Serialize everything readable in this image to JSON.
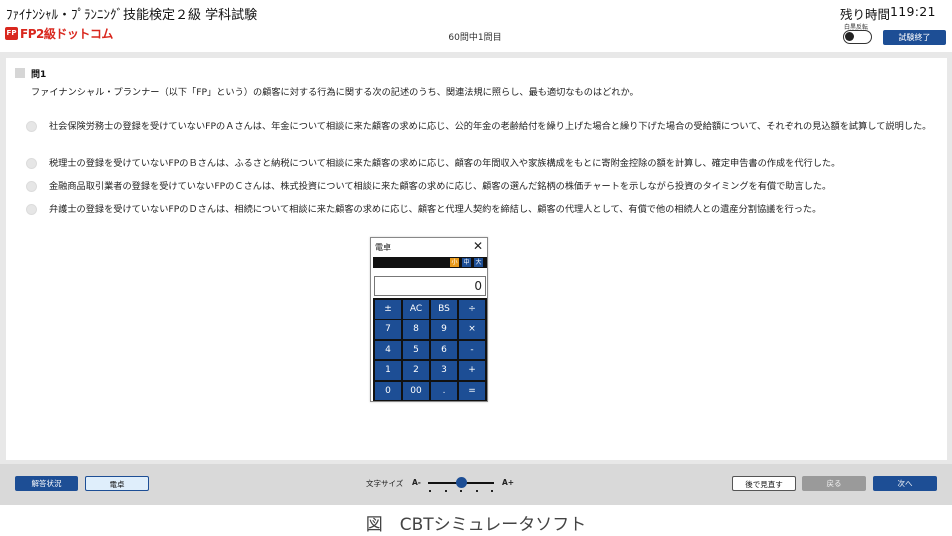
{
  "header": {
    "exam_title": "ﾌｧｲﾅﾝｼｬﾙ・ﾌﾟﾗﾝﾆﾝｸﾞ技能検定２級 学科試験",
    "logo_mark": "FP",
    "logo_text": "FP2級ドットコム",
    "progress": "60問中1問目",
    "time_label": "残り時間",
    "time_value": "119:21",
    "invert_label": "白黒反転",
    "end_button": "試験終了"
  },
  "question": {
    "number": "問1",
    "text": "ファイナンシャル・プランナー（以下「FP」という）の顧客に対する行為に関する次の記述のうち、関連法規に照らし、最も適切なものはどれか。",
    "choices": [
      "社会保険労務士の登録を受けていないFPのＡさんは、年金について相談に来た顧客の求めに応じ、公的年金の老齢給付を繰り上げた場合と繰り下げた場合の受給額について、それぞれの見込額を試算して説明した。",
      "税理士の登録を受けていないFPのＢさんは、ふるさと納税について相談に来た顧客の求めに応じ、顧客の年間収入や家族構成をもとに寄附金控除の額を計算し、確定申告書の作成を代行した。",
      "金融商品取引業者の登録を受けていないFPのＣさんは、株式投資について相談に来た顧客の求めに応じ、顧客の選んだ銘柄の株価チャートを示しながら投資のタイミングを有償で助言した。",
      "弁護士の登録を受けていないFPのＤさんは、相続について相談に来た顧客の求めに応じ、顧客と代理人契約を締結し、顧客の代理人として、有償で他の相続人との遺産分割協議を行った。"
    ]
  },
  "calculator": {
    "title": "電卓",
    "close": "✕",
    "sizes": [
      "小",
      "中",
      "大"
    ],
    "size_colors": [
      "#e89a1c",
      "#1d4e95",
      "#1d4e95"
    ],
    "display": "0",
    "keys": [
      [
        "±",
        "AC",
        "BS",
        "÷"
      ],
      [
        "7",
        "8",
        "9",
        "×"
      ],
      [
        "4",
        "5",
        "6",
        "-"
      ],
      [
        "1",
        "2",
        "3",
        "+"
      ],
      [
        "0",
        "00",
        ".",
        "="
      ]
    ]
  },
  "footer": {
    "answer_status": "解答状況",
    "calculator": "電卓",
    "font_size_label": "文字サイズ",
    "font_minus": "A-",
    "font_plus": "A+",
    "font_level": 0.5,
    "review_later": "後で見直す",
    "back": "戻る",
    "next": "次へ"
  },
  "caption": "図　CBTシミュレータソフト",
  "colors": {
    "accent": "#1d4e95",
    "logo": "#d9271e"
  }
}
